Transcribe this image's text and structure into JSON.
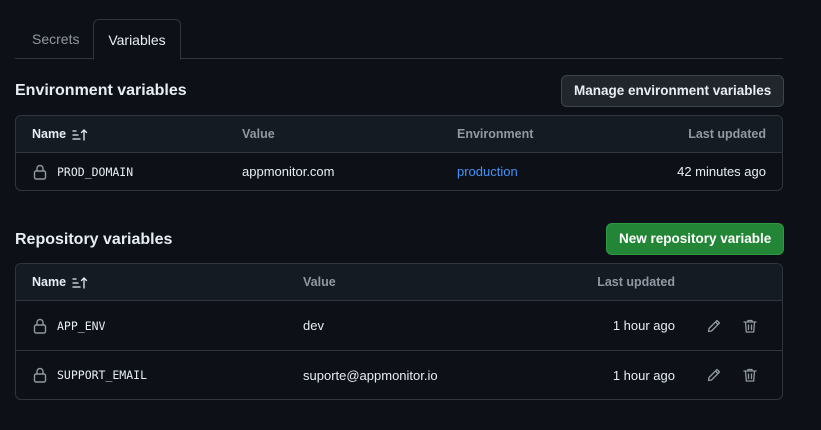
{
  "tabs": [
    {
      "label": "Secrets",
      "active": false
    },
    {
      "label": "Variables",
      "active": true
    }
  ],
  "environment": {
    "title": "Environment variables",
    "button": "Manage environment variables",
    "columns": {
      "name": "Name",
      "value": "Value",
      "environment": "Environment",
      "updated": "Last updated"
    },
    "rows": [
      {
        "name": "PROD_DOMAIN",
        "value": "appmonitor.com",
        "environment": "production",
        "updated": "42 minutes ago"
      }
    ]
  },
  "repository": {
    "title": "Repository variables",
    "button": "New repository variable",
    "columns": {
      "name": "Name",
      "value": "Value",
      "updated": "Last updated"
    },
    "rows": [
      {
        "name": "APP_ENV",
        "value": "dev",
        "updated": "1 hour ago"
      },
      {
        "name": "SUPPORT_EMAIL",
        "value": "suporte@appmonitor.io",
        "updated": "1 hour ago"
      }
    ]
  },
  "icons": {
    "sort": "sort-ascending-icon",
    "lock": "lock-icon",
    "edit": "pencil-icon",
    "delete": "trash-icon"
  },
  "colors": {
    "accent_link": "#4493f8",
    "primary_button": "#238636",
    "background": "#0d1117",
    "border": "#30363d"
  }
}
